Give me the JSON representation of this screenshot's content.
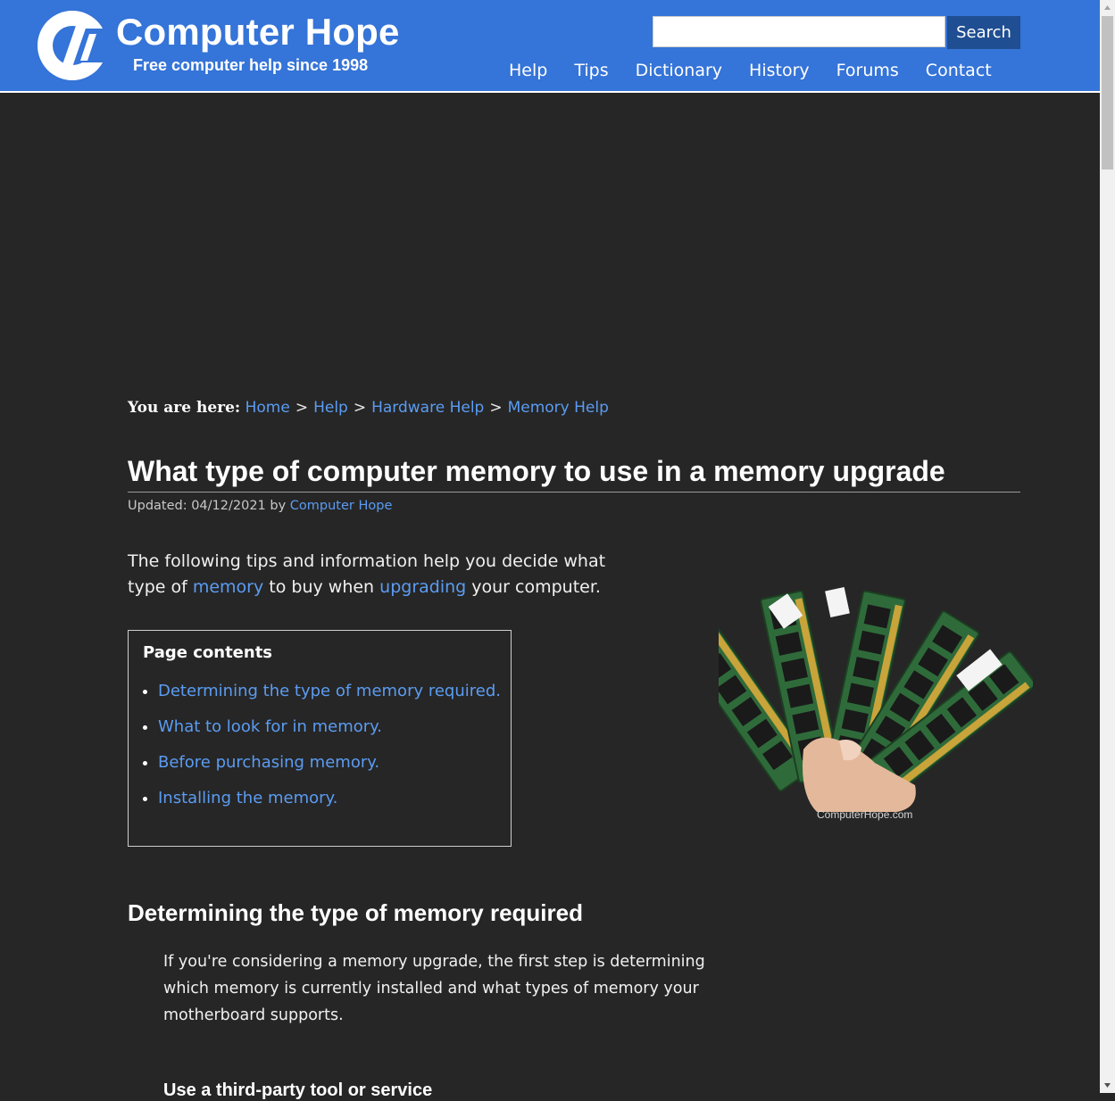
{
  "header": {
    "site_title": "Computer Hope",
    "tagline": "Free computer help since 1998",
    "search_value": "",
    "search_button": "Search",
    "nav": [
      "Help",
      "Tips",
      "Dictionary",
      "History",
      "Forums",
      "Contact"
    ],
    "brand_color": "#3574d8"
  },
  "breadcrumb": {
    "lead": "You are here:",
    "items": [
      "Home",
      "Help",
      "Hardware Help",
      "Memory Help"
    ],
    "separator": ">"
  },
  "article": {
    "title": "What type of computer memory to use in a memory upgrade",
    "updated_label": "Updated: 04/12/2021 by",
    "author": "Computer Hope",
    "intro": {
      "part1": "The following tips and information help you decide what type of",
      "link1": "memory",
      "part2": "to buy when",
      "link2": "upgrading",
      "part3": "your computer."
    },
    "contents": {
      "heading": "Page contents",
      "items": [
        "Determining the type of memory required.",
        "What to look for in memory.",
        "Before purchasing memory.",
        "Installing the memory."
      ]
    },
    "image_caption": "ComputerHope.com",
    "section": {
      "heading": "Determining the type of memory required",
      "text": "If you're considering a memory upgrade, the first step is determining which memory is currently installed and what types of memory your motherboard supports.",
      "subheading": "Use a third-party tool or service"
    }
  }
}
